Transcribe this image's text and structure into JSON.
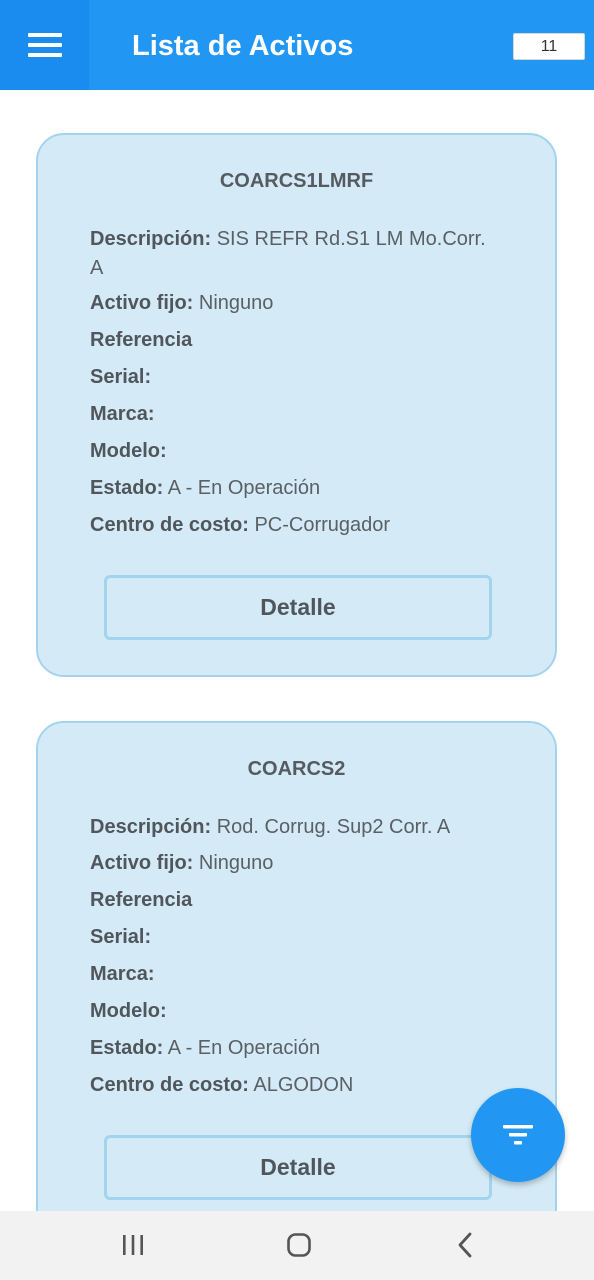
{
  "header": {
    "title": "Lista de Activos",
    "count": "11",
    "menu_icon": "hamburger-menu-icon"
  },
  "labels": {
    "descripcion": "Descripción:",
    "activo_fijo": "Activo fijo:",
    "referencia": "Referencia",
    "serial": "Serial:",
    "marca": "Marca:",
    "modelo": "Modelo:",
    "estado": "Estado:",
    "centro_costo": "Centro de costo:"
  },
  "assets": [
    {
      "code": "COARCS1LMRF",
      "descripcion": "SIS REFR Rd.S1 LM Mo.Corr. A",
      "activo_fijo": "Ninguno",
      "referencia": "",
      "serial": "",
      "marca": "",
      "modelo": "",
      "estado": "A - En Operación",
      "centro_costo": "PC-Corrugador",
      "button_label": "Detalle"
    },
    {
      "code": "COARCS2",
      "descripcion": "Rod. Corrug. Sup2 Corr. A",
      "activo_fijo": "Ninguno",
      "referencia": "",
      "serial": "",
      "marca": "",
      "modelo": "",
      "estado": "A - En Operación",
      "centro_costo": "ALGODON",
      "button_label": "Detalle"
    }
  ],
  "fab": {
    "icon": "filter-icon"
  },
  "navbar": {
    "recents_icon": "recent-apps-icon",
    "home_icon": "home-icon",
    "back_icon": "back-icon"
  },
  "colors": {
    "primary": "#2196f3",
    "card_background": "#d4ebf7",
    "card_border": "#a3d4ee",
    "text": "#50565b"
  }
}
